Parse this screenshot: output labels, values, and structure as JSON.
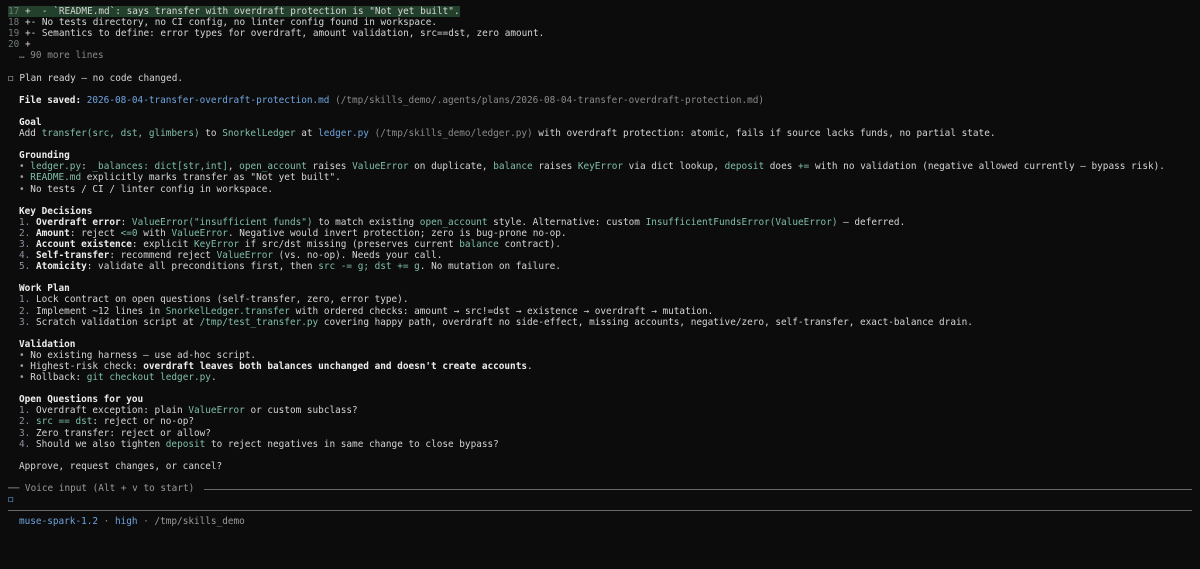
{
  "diff": {
    "lines": [
      {
        "num": "17",
        "sign": "+",
        "text": " - `README.md`: says transfer with overdraft protection is \"Not yet built\"."
      },
      {
        "num": "18",
        "sign": "+",
        "text": "- No tests directory, no CI config, no linter config found in workspace."
      },
      {
        "num": "19",
        "sign": "+",
        "text": "- Semantics to define: error types for overdraft, amount validation, src==dst, zero amount."
      },
      {
        "num": "20",
        "sign": "+",
        "text": ""
      }
    ],
    "more": "… 90 more lines"
  },
  "plan_status": {
    "glyph": "◻",
    "text": "Plan ready — no code changed."
  },
  "file_saved": {
    "label": "File saved:",
    "name": "2026-08-04-transfer-overdraft-protection.md",
    "path": "(/tmp/skills_demo/.agents/plans/2026-08-04-transfer-overdraft-protection.md)"
  },
  "goal": {
    "heading": "Goal",
    "t1": "Add ",
    "c1": "transfer(src, dst, glimbers)",
    "t2": " to ",
    "c2": "SnorkelLedger",
    "t3": " at ",
    "link": "ledger.py",
    "path": " (/tmp/skills_demo/ledger.py)",
    "t4": " with overdraft protection: atomic, fails if source lacks funds, no partial state."
  },
  "grounding": {
    "heading": "Grounding",
    "b1": {
      "c1": "ledger.py",
      "t1": ": ",
      "c2": "_balances: dict[str,int]",
      "t2": ", ",
      "c3": "open_account",
      "t3": " raises ",
      "c4": "ValueError",
      "t4": " on duplicate, ",
      "c5": "balance",
      "t5": " raises ",
      "c6": "KeyError",
      "t6": " via dict lookup, ",
      "c7": "deposit",
      "t7": " does ",
      "c8": "+=",
      "t8": " with no validation (negative allowed currently — bypass risk)."
    },
    "b2": {
      "c1": "README.md",
      "t1": " explicitly marks transfer as \"Not yet built\"."
    },
    "b3": {
      "t1": "No tests / CI / linter config in workspace."
    }
  },
  "decisions": {
    "heading": "Key Decisions",
    "d1": {
      "n": "1.",
      "b": "Overdraft error",
      "t1": ": ",
      "c1": "ValueError(\"insufficient funds\")",
      "t2": " to match existing ",
      "c2": "open_account",
      "t3": " style. Alternative: custom ",
      "c3": "InsufficientFundsError(ValueError)",
      "t4": " — deferred."
    },
    "d2": {
      "n": "2.",
      "b": "Amount",
      "t1": ": reject ",
      "c1": "<=0",
      "t2": " with ",
      "c2": "ValueError",
      "t3": ". Negative would invert protection; zero is bug-prone no-op."
    },
    "d3": {
      "n": "3.",
      "b": "Account existence",
      "t1": ": explicit ",
      "c1": "KeyError",
      "t2": " if src/dst missing (preserves current ",
      "c2": "balance",
      "t3": " contract)."
    },
    "d4": {
      "n": "4.",
      "b": "Self-transfer",
      "t1": ": recommend reject ",
      "c1": "ValueError",
      "t2": " (vs. no-op). Needs your call."
    },
    "d5": {
      "n": "5.",
      "b": "Atomicity",
      "t1": ": validate all preconditions first, then ",
      "c1": "src -= g; dst += g",
      "t2": ". No mutation on failure."
    }
  },
  "work_plan": {
    "heading": "Work Plan",
    "w1": {
      "n": "1.",
      "t1": "Lock contract on open questions (self-transfer, zero, error type)."
    },
    "w2": {
      "n": "2.",
      "t1": "Implement ~12 lines in ",
      "c1": "SnorkelLedger.transfer",
      "t2": " with ordered checks: amount → src!=dst → existence → overdraft → mutation."
    },
    "w3": {
      "n": "3.",
      "t1": "Scratch validation script at ",
      "c1": "/tmp/test_transfer.py",
      "t2": " covering happy path, overdraft no side-effect, missing accounts, negative/zero, self-transfer, exact-balance drain."
    }
  },
  "validation": {
    "heading": "Validation",
    "v1": {
      "t1": "No existing harness — use ad-hoc script."
    },
    "v2": {
      "t1": "Highest-risk check: ",
      "b": "overdraft leaves both balances unchanged and doesn't create accounts",
      "t2": "."
    },
    "v3": {
      "t1": "Rollback: ",
      "c1": "git checkout ledger.py",
      "t2": "."
    }
  },
  "questions": {
    "heading": "Open Questions for you",
    "q1": {
      "n": "1.",
      "t1": "Overdraft exception: plain ",
      "c1": "ValueError",
      "t2": " or custom subclass?"
    },
    "q2": {
      "n": "2.",
      "c1": "src == dst",
      "t1": ": reject or no-op?"
    },
    "q3": {
      "n": "3.",
      "t1": "Zero transfer: reject or allow?"
    },
    "q4": {
      "n": "4.",
      "t1": "Should we also tighten ",
      "c1": "deposit",
      "t2": " to reject negatives in same change to close bypass?"
    }
  },
  "prompt": "Approve, request changes, or cancel?",
  "voice": {
    "label": "── Voice input (Alt + v to start) "
  },
  "input_cursor": "◻",
  "status": {
    "model": "muse-spark-1.2",
    "sep": " · ",
    "effort": "high",
    "path": "/tmp/skills_demo"
  },
  "colors": {
    "background": "#0c0c0c",
    "code": "#7fbfa6",
    "link": "#6fa4e0",
    "diff_highlight": "#23402c"
  }
}
